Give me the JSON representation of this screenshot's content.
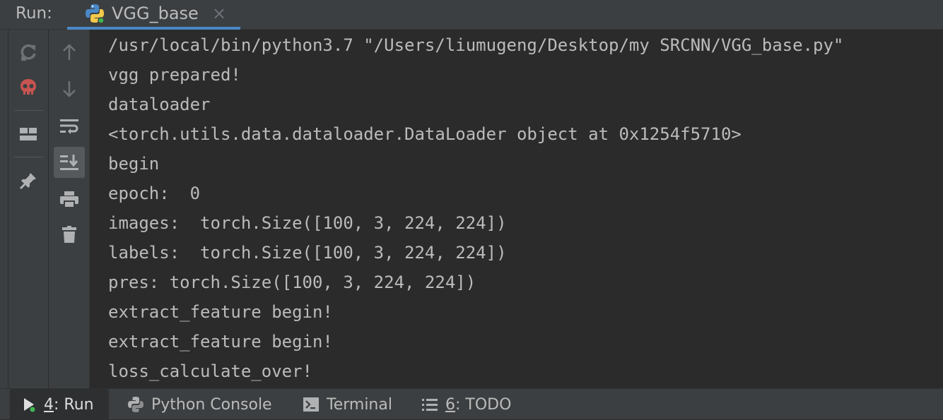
{
  "header": {
    "run_label": "Run:",
    "tab_label": "VGG_base",
    "tab_close": "×"
  },
  "console": {
    "lines": [
      "/usr/local/bin/python3.7 \"/Users/liumugeng/Desktop/my SRCNN/VGG_base.py\"",
      "vgg prepared!",
      "dataloader",
      "<torch.utils.data.dataloader.DataLoader object at 0x1254f5710>",
      "begin",
      "epoch:  0",
      "images:  torch.Size([100, 3, 224, 224])",
      "labels:  torch.Size([100, 3, 224, 224])",
      "pres: torch.Size([100, 3, 224, 224])",
      "extract_feature begin!",
      "extract_feature begin!",
      "loss_calculate_over!"
    ]
  },
  "bottom_tabs": [
    {
      "mnemonic": "4",
      "label": ": Run"
    },
    {
      "label": "Python Console"
    },
    {
      "label": "Terminal"
    },
    {
      "mnemonic": "6",
      "label": ": TODO"
    }
  ],
  "colors": {
    "background": "#2b2b2b",
    "panel": "#3c3f41",
    "accent": "#4a88c7",
    "text": "#bbbbbb",
    "stop_red": "#c75450"
  }
}
